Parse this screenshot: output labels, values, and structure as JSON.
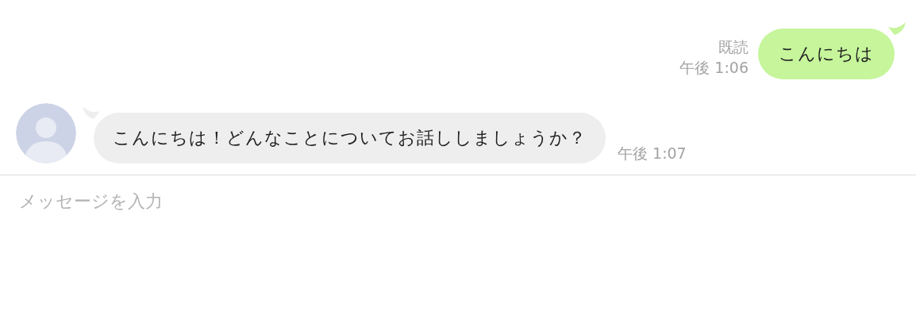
{
  "messages": [
    {
      "kind": "outgoing",
      "text": "こんにちは",
      "read": "既読",
      "time": "午後 1:06"
    },
    {
      "kind": "incoming",
      "text": "こんにちは！どんなことについてお話ししましょうか？",
      "time": "午後 1:07"
    }
  ],
  "input": {
    "placeholder": "メッセージを入力"
  }
}
